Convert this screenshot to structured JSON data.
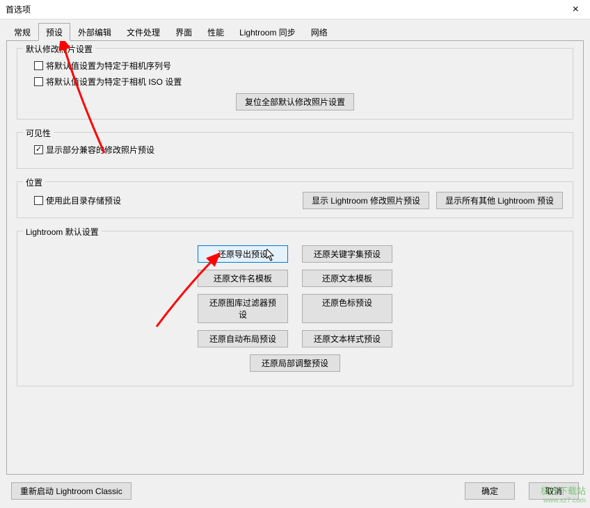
{
  "window": {
    "title": "首选项"
  },
  "tabs": [
    {
      "label": "常规"
    },
    {
      "label": "预设",
      "active": true
    },
    {
      "label": "外部编辑"
    },
    {
      "label": "文件处理"
    },
    {
      "label": "界面"
    },
    {
      "label": "性能"
    },
    {
      "label": "Lightroom 同步"
    },
    {
      "label": "网络"
    }
  ],
  "group_defaults_modify": {
    "title": "默认修改照片设置",
    "cb_camera_serial": {
      "checked": false,
      "label": "将默认值设置为特定于相机序列号"
    },
    "cb_camera_iso": {
      "checked": false,
      "label": "将默认值设置为特定于相机 ISO 设置"
    },
    "reset_btn": "复位全部默认修改照片设置"
  },
  "group_visibility": {
    "title": "可见性",
    "cb_show_partial": {
      "checked": true,
      "label": "显示部分兼容的修改照片预设"
    }
  },
  "group_location": {
    "title": "位置",
    "cb_use_dir": {
      "checked": false,
      "label": "使用此目录存储预设"
    },
    "btn_show_develop": "显示 Lightroom 修改照片预设",
    "btn_show_all": "显示所有其他 Lightroom 预设"
  },
  "group_lr_defaults": {
    "title": "Lightroom 默认设置",
    "btn_export": "还原导出预设",
    "btn_keywords": "还原关键字集预设",
    "btn_filename": "还原文件名模板",
    "btn_text_tmpl": "还原文本模板",
    "btn_lib_filter": "还原图库过滤器预设",
    "btn_color_label": "还原色标预设",
    "btn_autolayout": "还原自动布局预设",
    "btn_textstyle": "还原文本样式预设",
    "btn_local_adj": "还原局部调整预设"
  },
  "footer": {
    "restart": "重新启动 Lightroom Classic",
    "ok": "确定",
    "cancel": "取消"
  },
  "watermark": {
    "name": "极光下载站",
    "url": "www.xz7.com"
  },
  "annotation": {
    "color": "#ff0000"
  }
}
